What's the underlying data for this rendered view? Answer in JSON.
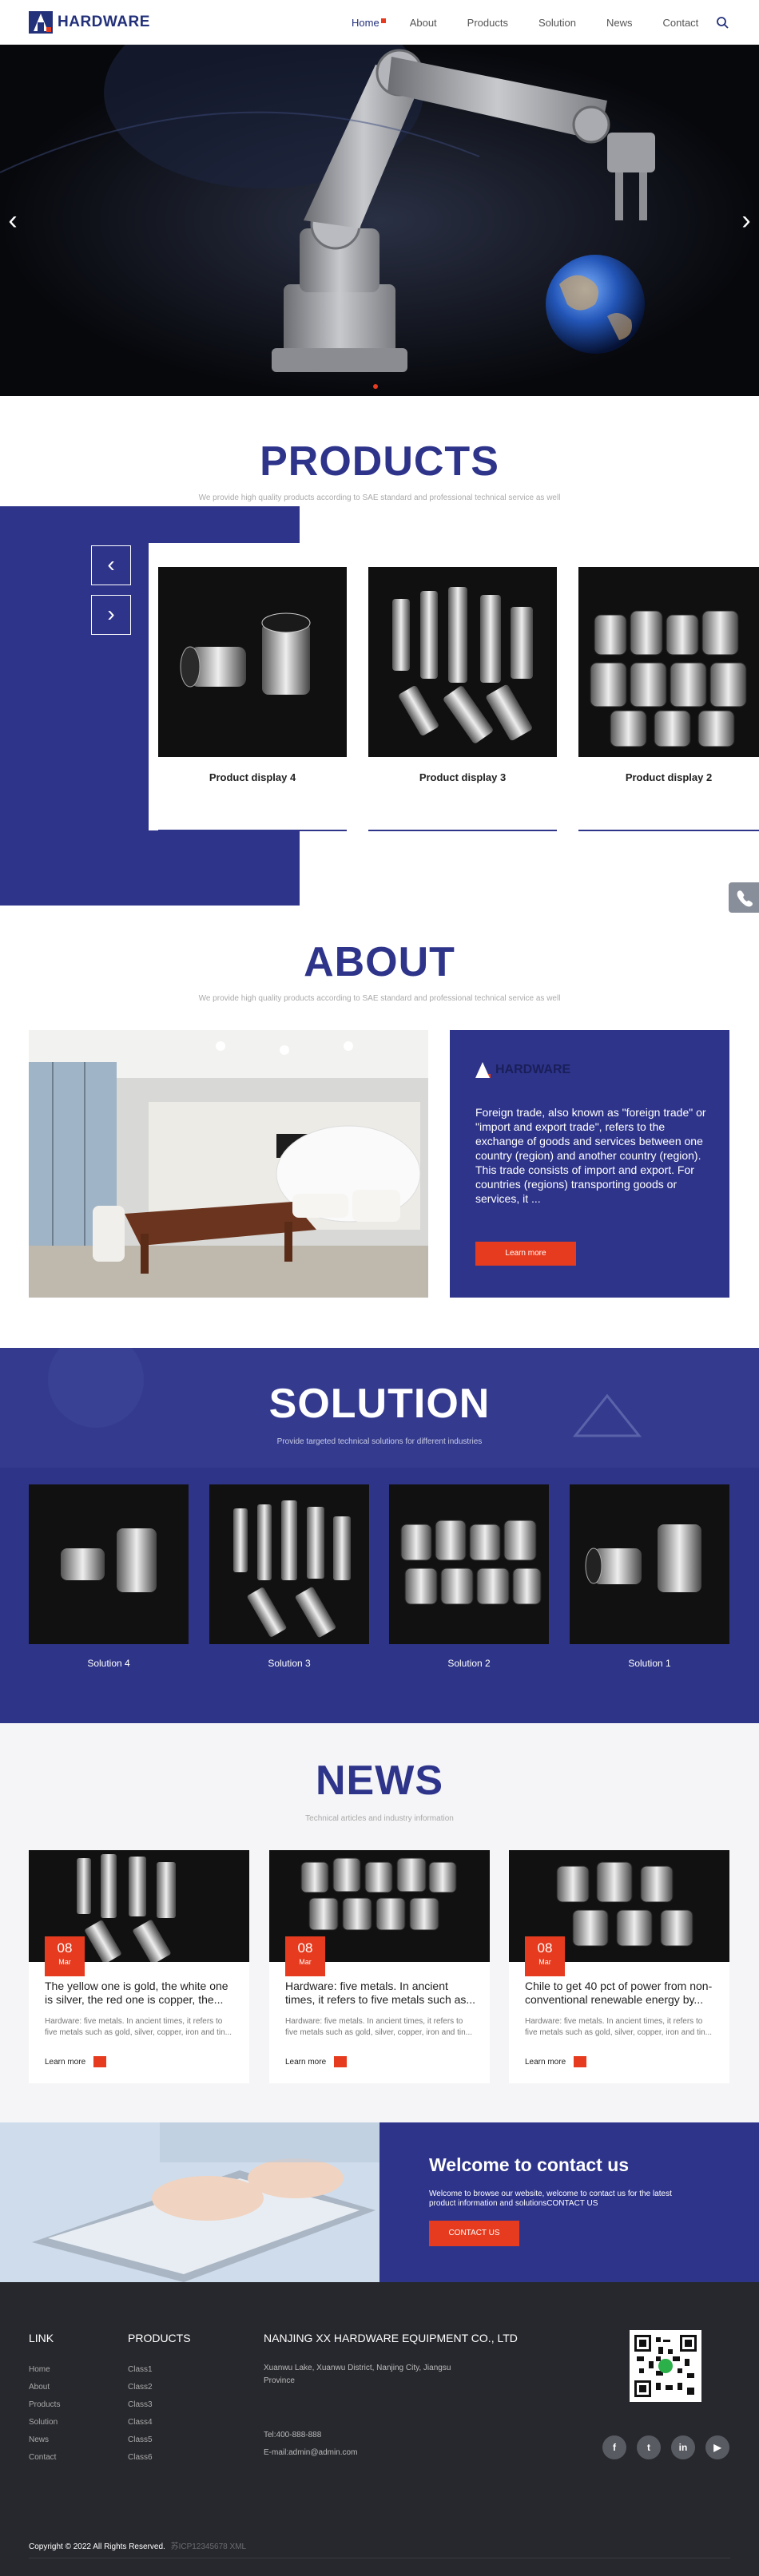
{
  "header": {
    "logo_text": "HARDWARE",
    "nav": [
      "Home",
      "About",
      "Products",
      "Solution",
      "News",
      "Contact"
    ]
  },
  "products": {
    "title": "PRODUCTS",
    "subtitle": "We provide high quality products according to SAE standard and professional technical service as well",
    "items": [
      "Product display 4",
      "Product display 3",
      "Product display 2"
    ]
  },
  "about": {
    "title": "ABOUT",
    "subtitle": "We provide high quality products according to SAE standard and professional technical service as well",
    "logo_text": "HARDWARE",
    "text": "Foreign trade, also known as \"foreign trade\" or \"import and export trade\", refers to the exchange of goods and services between one country (region) and another country (region). This trade consists of import and export. For countries (regions) transporting goods or services, it ...",
    "button": "Learn more"
  },
  "solution": {
    "title": "SOLUTION",
    "subtitle": "Provide targeted technical solutions for different industries",
    "items": [
      "Solution 4",
      "Solution 3",
      "Solution 2",
      "Solution 1"
    ]
  },
  "news": {
    "title": "NEWS",
    "subtitle": "Technical articles and industry information",
    "items": [
      {
        "day": "08",
        "month": "Mar",
        "title": "The yellow one is gold, the white one is silver, the red one is copper, the...",
        "excerpt": "Hardware: five metals. In ancient times, it refers to five metals such as gold, silver, copper, iron and tin...",
        "more": "Learn more"
      },
      {
        "day": "08",
        "month": "Mar",
        "title": "Hardware: five metals. In ancient times, it refers to five metals such as...",
        "excerpt": "Hardware: five metals. In ancient times, it refers to five metals such as gold, silver, copper, iron and tin...",
        "more": "Learn more"
      },
      {
        "day": "08",
        "month": "Mar",
        "title": "Chile to get 40 pct of power from non-conventional renewable energy by...",
        "excerpt": "Hardware: five metals. In ancient times, it refers to five metals such as gold, silver, copper, iron and tin...",
        "more": "Learn more"
      }
    ]
  },
  "contact_band": {
    "title": "Welcome to contact us",
    "text": "Welcome to browse our website, welcome to contact us for the latest product information and solutionsCONTACT US",
    "button": "CONTACT US"
  },
  "footer": {
    "link_title": "LINK",
    "links": [
      "Home",
      "About",
      "Products",
      "Solution",
      "News",
      "Contact"
    ],
    "products_title": "PRODUCTS",
    "products": [
      "Class1",
      "Class2",
      "Class3",
      "Class4",
      "Class5",
      "Class6"
    ],
    "company": "NANJING XX HARDWARE EQUIPMENT CO., LTD",
    "address": "Xuanwu Lake, Xuanwu District, Nanjing City, Jiangsu Province",
    "tel": "Tel:400-888-888",
    "email": "E-mail:admin@admin.com",
    "social": [
      "f",
      "t",
      "in",
      "▶"
    ],
    "copyright": "Copyright © 2022 All Rights Reserved.",
    "icp": "苏ICP12345678 XML"
  },
  "colors": {
    "brand": "#2e348a",
    "accent": "#e63b1e",
    "footer": "#27282d"
  }
}
